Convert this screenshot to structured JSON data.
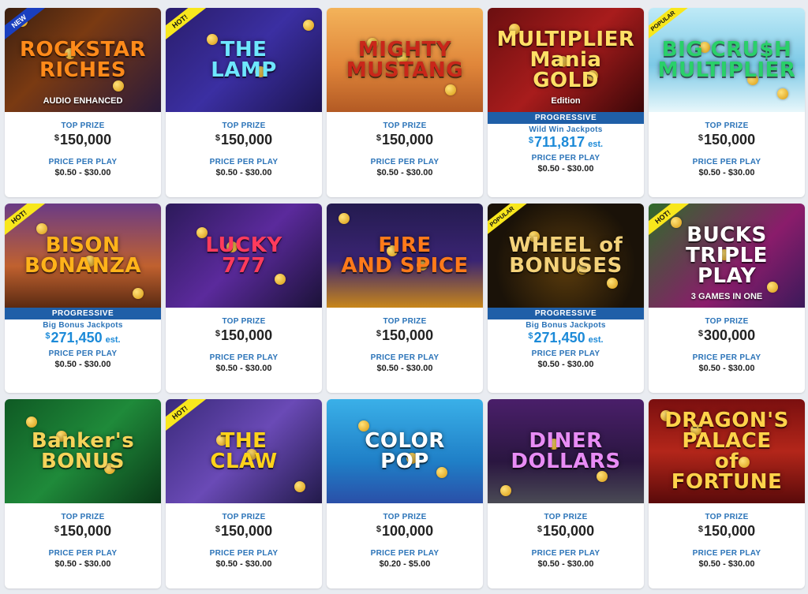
{
  "labels": {
    "top_prize": "TOP PRIZE",
    "price_per_play": "PRICE PER PLAY",
    "progressive": "PROGRESSIVE",
    "estimate": "est.",
    "currency": "$"
  },
  "games": [
    {
      "title": "ROCKSTAR\nRICHES",
      "subtitle": "AUDIO ENHANCED",
      "ribbon": "NEW",
      "ribbon_type": "new",
      "top_prize": "150,000",
      "price": "$0.50 - $30.00",
      "bg": "linear-gradient(135deg,#3a1f10 0%,#7a3a12 40%,#2b1a3a 100%)",
      "title_color": "#ff8a1a"
    },
    {
      "title": "THE\nLAMP",
      "ribbon": "HOT!",
      "ribbon_type": "hot",
      "top_prize": "150,000",
      "price": "$0.50 - $30.00",
      "bg": "linear-gradient(135deg,#2a1d6b 0%,#3b2fa2 50%,#1c1450 100%)",
      "title_color": "#6ee7ff"
    },
    {
      "title": "MIGHTY\nMUSTANG",
      "top_prize": "150,000",
      "price": "$0.50 - $30.00",
      "bg": "linear-gradient(180deg,#f3b35a 0%,#e0863a 55%,#b35a24 100%)",
      "title_color": "#c9271a"
    },
    {
      "title": "MULTIPLIER\nMania GOLD",
      "subtitle": "Edition",
      "progressive": true,
      "jackpot_label": "Wild Win Jackpots",
      "jackpot": "711,817",
      "price": "$0.50 - $30.00",
      "bg": "linear-gradient(135deg,#6b0f10 0%,#a81c1c 50%,#3a0708 100%)",
      "title_color": "#ffe066"
    },
    {
      "title": "BIG CRU$H\nMULTIPLIER",
      "ribbon": "POPULAR",
      "ribbon_type": "popular",
      "top_prize": "150,000",
      "price": "$0.50 - $30.00",
      "bg": "linear-gradient(180deg,#bfeaf7 0%,#7cc9e6 55%,#e8f7fb 100%)",
      "title_color": "#2ad06a"
    },
    {
      "title": "BISON\nBONANZA",
      "ribbon": "HOT!",
      "ribbon_type": "hot",
      "progressive": true,
      "jackpot_label": "Big Bonus Jackpots",
      "jackpot": "271,450",
      "price": "$0.50 - $30.00",
      "bg": "linear-gradient(180deg,#6a3b86 0%,#c0612f 60%,#5a2a12 100%)",
      "title_color": "#ffb31a"
    },
    {
      "title": "LUCKY\n777",
      "top_prize": "150,000",
      "price": "$0.50 - $30.00",
      "bg": "linear-gradient(135deg,#2c1a5a 0%,#5b2a9c 50%,#1b1238 100%)",
      "title_color": "#ff3b5c"
    },
    {
      "title": "FIRE\nAND SPICE",
      "top_prize": "150,000",
      "price": "$0.50 - $30.00",
      "bg": "linear-gradient(180deg,#241b4f 0%,#3a2473 55%,#c8861a 100%)",
      "title_color": "#ff7a1a"
    },
    {
      "title": "WHEEL of BONUSES",
      "ribbon": "POPULAR",
      "ribbon_type": "popular",
      "progressive": true,
      "jackpot_label": "Big Bonus Jackpots",
      "jackpot": "271,450",
      "price": "$0.50 - $30.00",
      "bg": "radial-gradient(circle at 50% 60%,#5a3b0c 0%,#1a1208 70%)",
      "title_color": "#f4d27a"
    },
    {
      "title": "BUCKS\nTRIPLE PLAY",
      "subtitle": "3 GAMES IN ONE",
      "ribbon": "HOT!",
      "ribbon_type": "hot",
      "top_prize": "300,000",
      "price": "$0.50 - $30.00",
      "bg": "linear-gradient(135deg,#2f6b2a 0%,#8a1c6b 60%,#3b1a5a 100%)",
      "title_color": "#ffffff"
    },
    {
      "title": "Banker's\nBONUS",
      "top_prize": "150,000",
      "price": "$0.50 - $30.00",
      "bg": "linear-gradient(135deg,#0f5a24 0%,#1f8a3a 50%,#0a3a18 100%)",
      "title_color": "#f5d35a"
    },
    {
      "title": "THE\nCLAW",
      "ribbon": "HOT!",
      "ribbon_type": "hot",
      "top_prize": "150,000",
      "price": "$0.50 - $30.00",
      "bg": "linear-gradient(135deg,#3a2a7a 0%,#6a4ab6 50%,#221a4a 100%)",
      "title_color": "#ffd21a"
    },
    {
      "title": "COLOR\nPOP",
      "top_prize": "100,000",
      "price": "$0.20 - $5.00",
      "bg": "linear-gradient(180deg,#3ab0e8 0%,#1f7fc7 60%,#2a4fa8 100%)",
      "title_color": "#ffffff"
    },
    {
      "title": "DINER\nDOLLARS",
      "top_prize": "150,000",
      "price": "$0.50 - $30.00",
      "bg": "linear-gradient(180deg,#4a1f6a 0%,#2a1640 60%,#4a4a55 100%)",
      "title_color": "#e88cf5"
    },
    {
      "title": "DRAGON'S PALACE\nof FORTUNE",
      "top_prize": "150,000",
      "price": "$0.50 - $30.00",
      "bg": "linear-gradient(180deg,#7a0f0f 0%,#b3261a 50%,#5a0a0a 100%)",
      "title_color": "#ffd34a"
    }
  ]
}
